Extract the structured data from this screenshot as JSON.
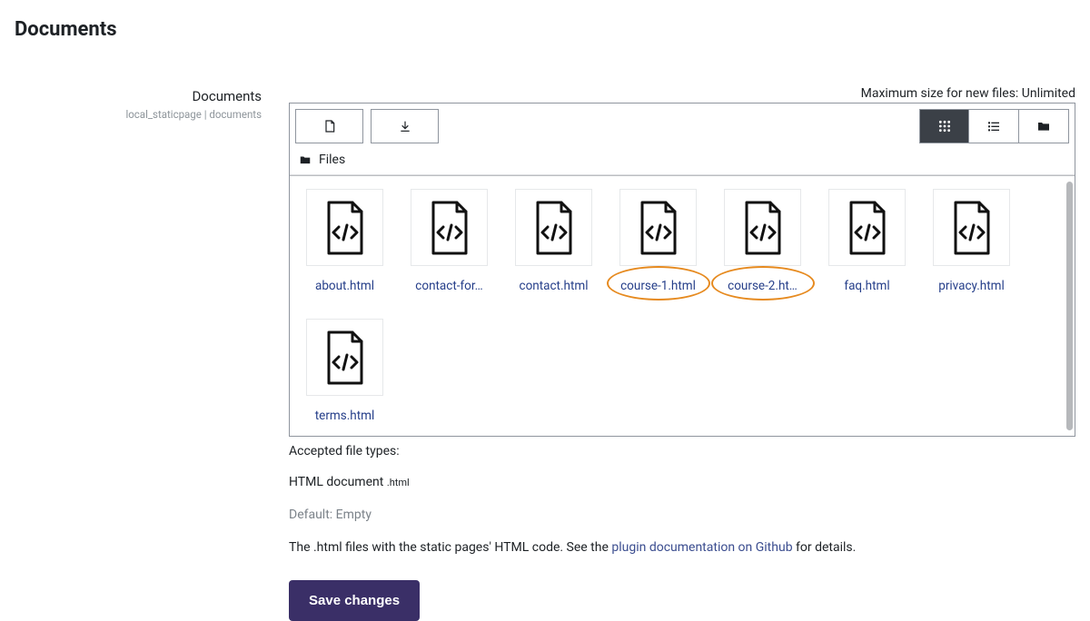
{
  "page_title": "Documents",
  "field": {
    "label": "Documents",
    "sub": "local_staticpage | documents"
  },
  "max_size_label": "Maximum size for new files: Unlimited",
  "path_label": "Files",
  "files": [
    {
      "label": "about.html",
      "circled": false
    },
    {
      "label": "contact-for…",
      "circled": false
    },
    {
      "label": "contact.html",
      "circled": false
    },
    {
      "label": "course-1.html",
      "circled": true
    },
    {
      "label": "course-2.ht…",
      "circled": true
    },
    {
      "label": "faq.html",
      "circled": false
    },
    {
      "label": "privacy.html",
      "circled": false
    },
    {
      "label": "terms.html",
      "circled": false
    }
  ],
  "accepted_label": "Accepted file types:",
  "accepted_type_name": "HTML document",
  "accepted_type_ext": ".html",
  "default_label": "Default: Empty",
  "description_prefix": "The .html files with the static pages' HTML code. See the ",
  "description_link": "plugin documentation on Github",
  "description_suffix": " for details.",
  "save_label": "Save changes"
}
